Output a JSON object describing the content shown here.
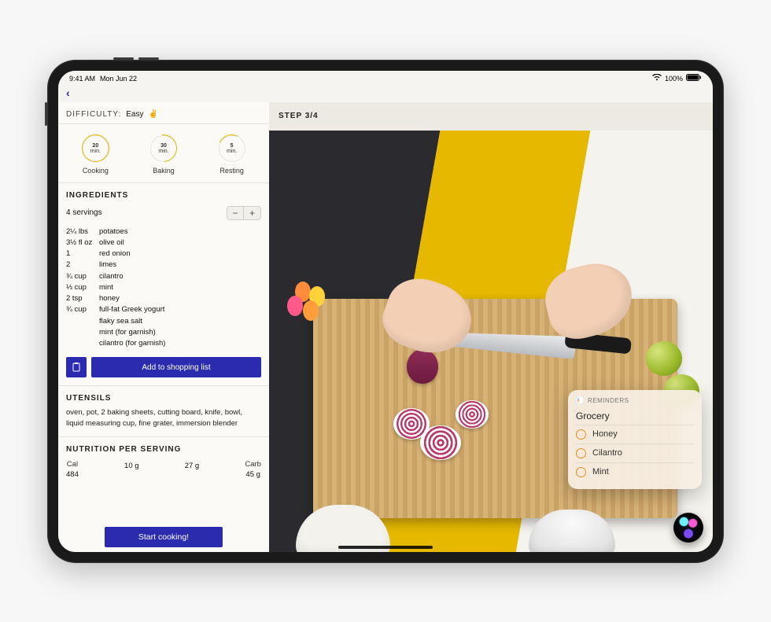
{
  "status": {
    "time": "9:41 AM",
    "date": "Mon Jun 22",
    "wifi": "wifi",
    "battery_pct": "100%"
  },
  "difficulty": {
    "label": "DIFFICULTY:",
    "value": "Easy",
    "emoji": "✌️"
  },
  "timers": [
    {
      "value": "20",
      "unit": "min.",
      "label": "Cooking",
      "ring": "full"
    },
    {
      "value": "30",
      "unit": "min.",
      "label": "Baking",
      "ring": "partial"
    },
    {
      "value": "5",
      "unit": "min.",
      "label": "Resting",
      "ring": "small"
    }
  ],
  "ingredients": {
    "heading": "INGREDIENTS",
    "servings": "4 servings",
    "rows": [
      {
        "qty": "2¼ lbs",
        "item": "potatoes"
      },
      {
        "qty": "3½ fl oz",
        "item": "olive oil"
      },
      {
        "qty": "1",
        "item": "red onion"
      },
      {
        "qty": "2",
        "item": "limes"
      },
      {
        "qty": "¾ cup",
        "item": "cilantro"
      },
      {
        "qty": "⅓ cup",
        "item": "mint"
      },
      {
        "qty": "2 tsp",
        "item": "honey"
      },
      {
        "qty": "¾ cup",
        "item": "full-fat Greek yogurt"
      },
      {
        "qty": "",
        "item": "flaky sea salt"
      },
      {
        "qty": "",
        "item": "mint (for garnish)"
      },
      {
        "qty": "",
        "item": "cilantro (for garnish)"
      }
    ],
    "add_label": "Add to shopping list"
  },
  "utensils": {
    "heading": "UTENSILS",
    "text": "oven, pot, 2 baking sheets, cutting board, knife, bowl, liquid measuring cup, fine grater, immersion blender"
  },
  "nutrition": {
    "heading": "NUTRITION PER SERVING",
    "cols": [
      {
        "h": "Cal",
        "v": "484"
      },
      {
        "h": "",
        "v": "10 g"
      },
      {
        "h": "",
        "v": "27 g"
      },
      {
        "h": "Carb",
        "v": "45 g"
      }
    ]
  },
  "start_label": "Start cooking!",
  "step_header": "STEP 3/4",
  "reminders": {
    "app": "REMINDERS",
    "list": "Grocery",
    "items": [
      "Honey",
      "Cilantro",
      "Mint"
    ]
  }
}
